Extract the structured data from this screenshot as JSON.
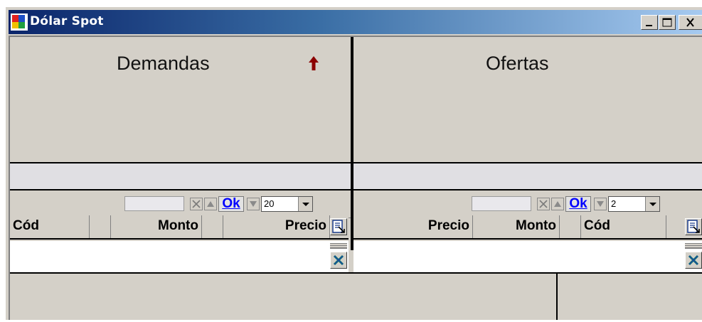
{
  "window": {
    "title": "Dólar Spot"
  },
  "demandas": {
    "heading": "Demandas",
    "sort_indicator": "arrow-up-icon",
    "toolbar": {
      "ok_label": "Ok",
      "count": "20"
    },
    "columns": [
      "Cód",
      "",
      "Monto",
      "",
      "Precio"
    ]
  },
  "ofertas": {
    "heading": "Ofertas",
    "toolbar": {
      "ok_label": "Ok",
      "count": "2"
    },
    "columns": [
      "Precio",
      "Monto",
      "",
      "Cód"
    ]
  },
  "colors": {
    "title_start": "#0a246a",
    "title_end": "#a6caf0",
    "face": "#d4d0c8",
    "ok_text": "#0000ff",
    "arrow": "#8b0000"
  }
}
